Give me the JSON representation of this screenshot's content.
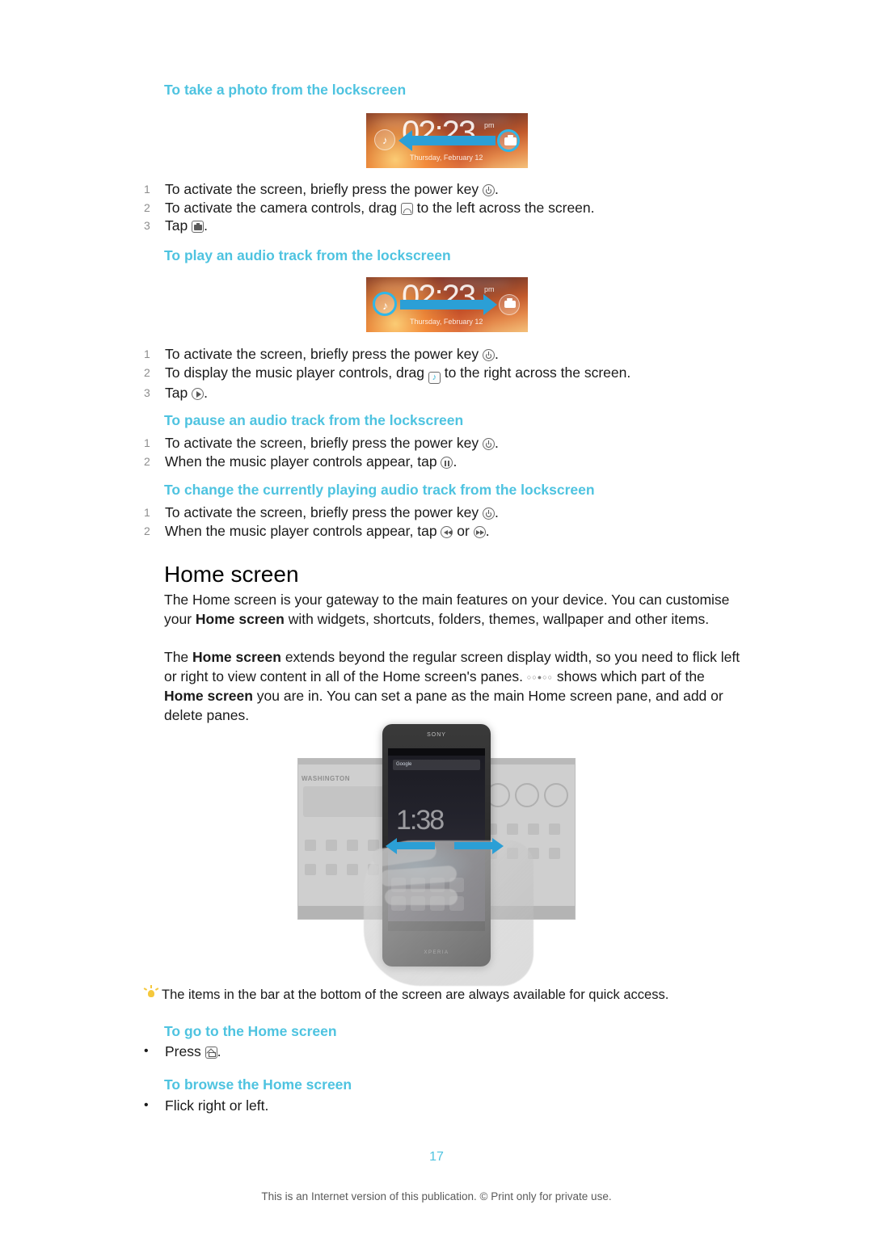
{
  "document": {
    "page_number": "17",
    "footer": "This is an Internet version of this publication. © Print only for private use.",
    "heading_color": "#4ec3e0"
  },
  "sections": [
    {
      "id": "take-photo",
      "heading": "To take a photo from the lockscreen",
      "steps": [
        {
          "num": "1",
          "text_before": "To activate the screen, briefly press the power key ",
          "icon": "power-key-icon",
          "text_after": "."
        },
        {
          "num": "2",
          "text_before": "To activate the camera controls, drag ",
          "icon": "swipe-handle-icon",
          "text_after": " to the left across the screen."
        },
        {
          "num": "3",
          "text_before": "Tap ",
          "icon": "camera-icon",
          "text_after": "."
        }
      ]
    },
    {
      "id": "play-audio",
      "heading": "To play an audio track from the lockscreen",
      "steps": [
        {
          "num": "1",
          "text_before": "To activate the screen, briefly press the power key ",
          "icon": "power-key-icon",
          "text_after": "."
        },
        {
          "num": "2",
          "text_before": "To display the music player controls, drag ",
          "icon": "music-note-icon",
          "text_after": " to the right across the screen."
        },
        {
          "num": "3",
          "text_before": "Tap ",
          "icon": "play-icon",
          "text_after": "."
        }
      ]
    },
    {
      "id": "pause-audio",
      "heading": "To pause an audio track from the lockscreen",
      "steps": [
        {
          "num": "1",
          "text_before": "To activate the screen, briefly press the power key ",
          "icon": "power-key-icon",
          "text_after": "."
        },
        {
          "num": "2",
          "text_before": "When the music player controls appear, tap ",
          "icon": "pause-icon",
          "text_after": "."
        }
      ]
    },
    {
      "id": "change-track",
      "heading": "To change the currently playing audio track from the lockscreen",
      "steps": [
        {
          "num": "1",
          "text_before": "To activate the screen, briefly press the power key ",
          "icon": "power-key-icon",
          "text_after": "."
        },
        {
          "num": "2",
          "text_before": "When the music player controls appear, tap ",
          "icon": "previous-track-icon",
          "text_middle": " or ",
          "icon2": "next-track-icon",
          "text_after": "."
        }
      ]
    }
  ],
  "home_screen": {
    "heading": "Home screen",
    "paragraph_1": {
      "part1": "The Home screen is your gateway to the main features on your device. You can customise your ",
      "bold1": "Home screen",
      "part2": " with widgets, shortcuts, folders, themes, wallpaper and other items."
    },
    "paragraph_2": {
      "part1": "The ",
      "bold1": "Home screen",
      "part2": " extends beyond the regular screen display width, so you need to flick left or right to view content in all of the Home screen's panes. ",
      "pane_dots": "○○●○○",
      "part3": " shows which part of the ",
      "bold2": "Home screen",
      "part4": " you are in. You can set a pane as the main Home screen pane, and add or delete panes."
    },
    "tip": "The items in the bar at the bottom of the screen are always available for quick access.",
    "subsections": [
      {
        "heading": "To go to the Home screen",
        "steps": [
          {
            "bullet": "•",
            "text_before": "Press ",
            "icon": "home-key-icon",
            "text_after": "."
          }
        ]
      },
      {
        "heading": "To browse the Home screen",
        "steps": [
          {
            "bullet": "•",
            "text_before": "Flick right or left.",
            "icon": "",
            "text_after": ""
          }
        ]
      }
    ]
  },
  "lockscreen_images": [
    {
      "id": "camera-lockscreen",
      "time": "02:23",
      "ampm": "pm",
      "date": "Thursday, February 12",
      "left_icon": "music-note-icon",
      "right_icon": "camera-icon",
      "highlighted_icon": "camera-icon",
      "arrow_direction": "left",
      "arrow_color": "#2b9fd6"
    },
    {
      "id": "music-lockscreen",
      "time": "02:23",
      "ampm": "pm",
      "date": "Thursday, February 12",
      "left_icon": "music-note-icon",
      "right_icon": "camera-icon",
      "highlighted_icon": "music-note-icon",
      "arrow_direction": "right",
      "arrow_color": "#2b9fd6"
    }
  ],
  "home_screen_illustration": {
    "device_brand": "SONY",
    "device_series": "XPERIA",
    "widget_time": "1:38",
    "search_placeholder": "Google",
    "left_pane_label": "WASHINGTON",
    "arrow_left": "flick-left-arrow",
    "arrow_right": "flick-right-arrow"
  }
}
